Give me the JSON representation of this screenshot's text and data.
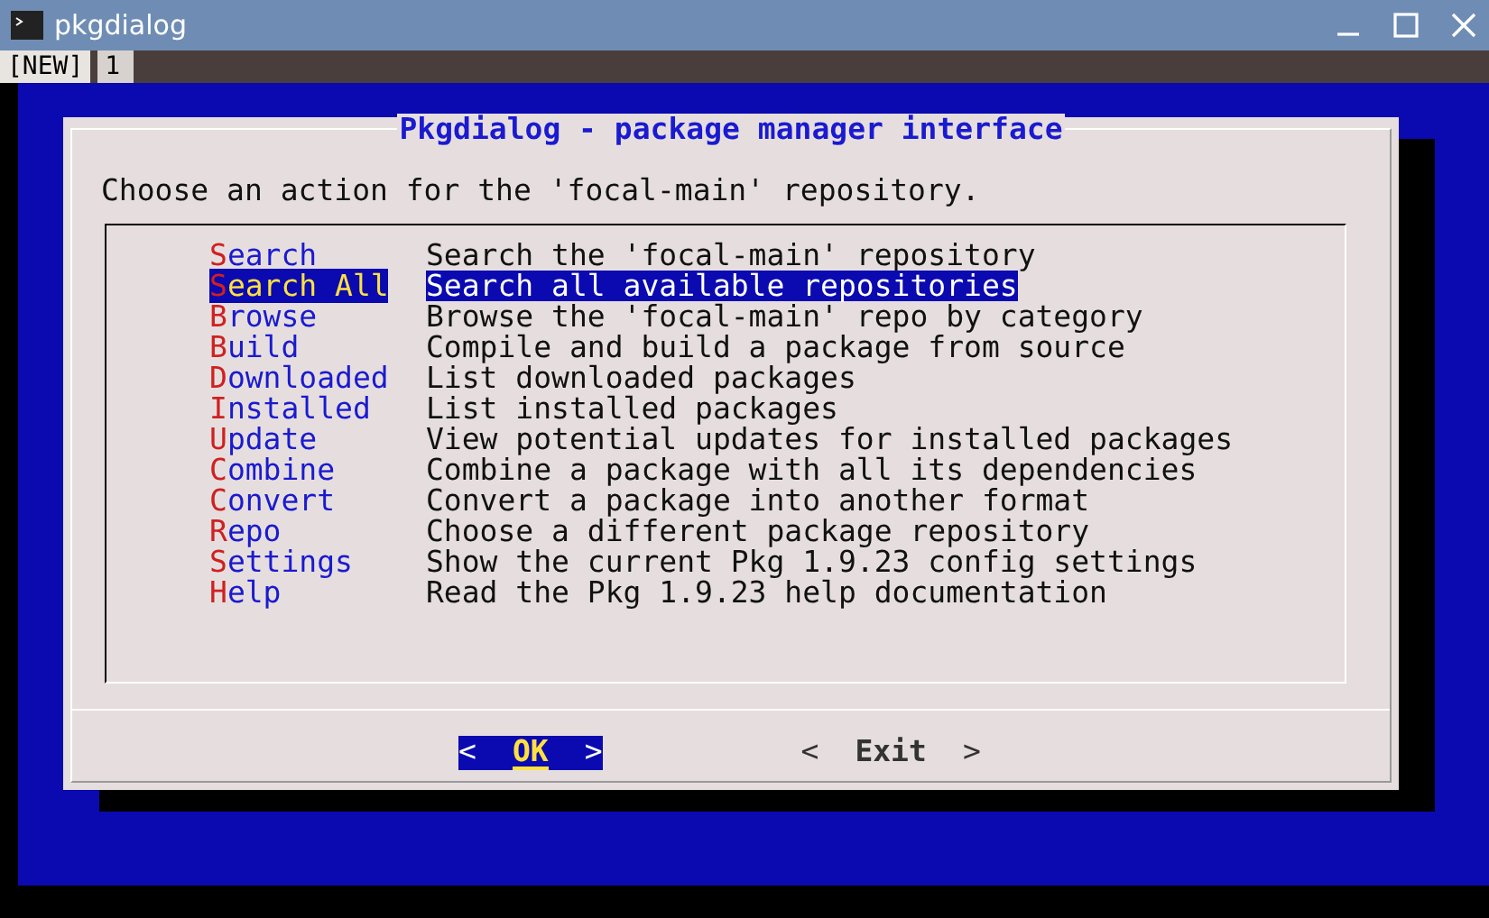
{
  "window": {
    "title": "pkgdialog"
  },
  "tmux_tabs": [
    {
      "label": "[NEW]",
      "selected": false
    },
    {
      "label": "1",
      "selected": true
    }
  ],
  "dialog": {
    "title": "Pkgdialog - package manager interface",
    "prompt": "Choose an action for the 'focal-main' repository.",
    "items": [
      {
        "tag": "Search",
        "description": "Search the 'focal-main' repository",
        "selected": false
      },
      {
        "tag": "Search All",
        "description": "Search all available repositories",
        "selected": true
      },
      {
        "tag": "Browse",
        "description": "Browse the 'focal-main' repo by category",
        "selected": false
      },
      {
        "tag": "Build",
        "description": "Compile and build a package from source",
        "selected": false
      },
      {
        "tag": "Downloaded",
        "description": "List downloaded packages",
        "selected": false
      },
      {
        "tag": "Installed",
        "description": "List installed packages",
        "selected": false
      },
      {
        "tag": "Update",
        "description": "View potential updates for installed packages",
        "selected": false
      },
      {
        "tag": "Combine",
        "description": "Combine a package with all its dependencies",
        "selected": false
      },
      {
        "tag": "Convert",
        "description": "Convert a package into another format",
        "selected": false
      },
      {
        "tag": "Repo",
        "description": "Choose a different package repository",
        "selected": false
      },
      {
        "tag": "Settings",
        "description": "Show the current Pkg 1.9.23 config settings",
        "selected": false
      },
      {
        "tag": "Help",
        "description": "Read the Pkg 1.9.23 help documentation",
        "selected": false
      }
    ],
    "buttons": [
      {
        "open": "<",
        "label": "OK",
        "close": ">",
        "selected": true
      },
      {
        "open": "<",
        "label": "Exit",
        "close": ">",
        "selected": false
      }
    ]
  }
}
